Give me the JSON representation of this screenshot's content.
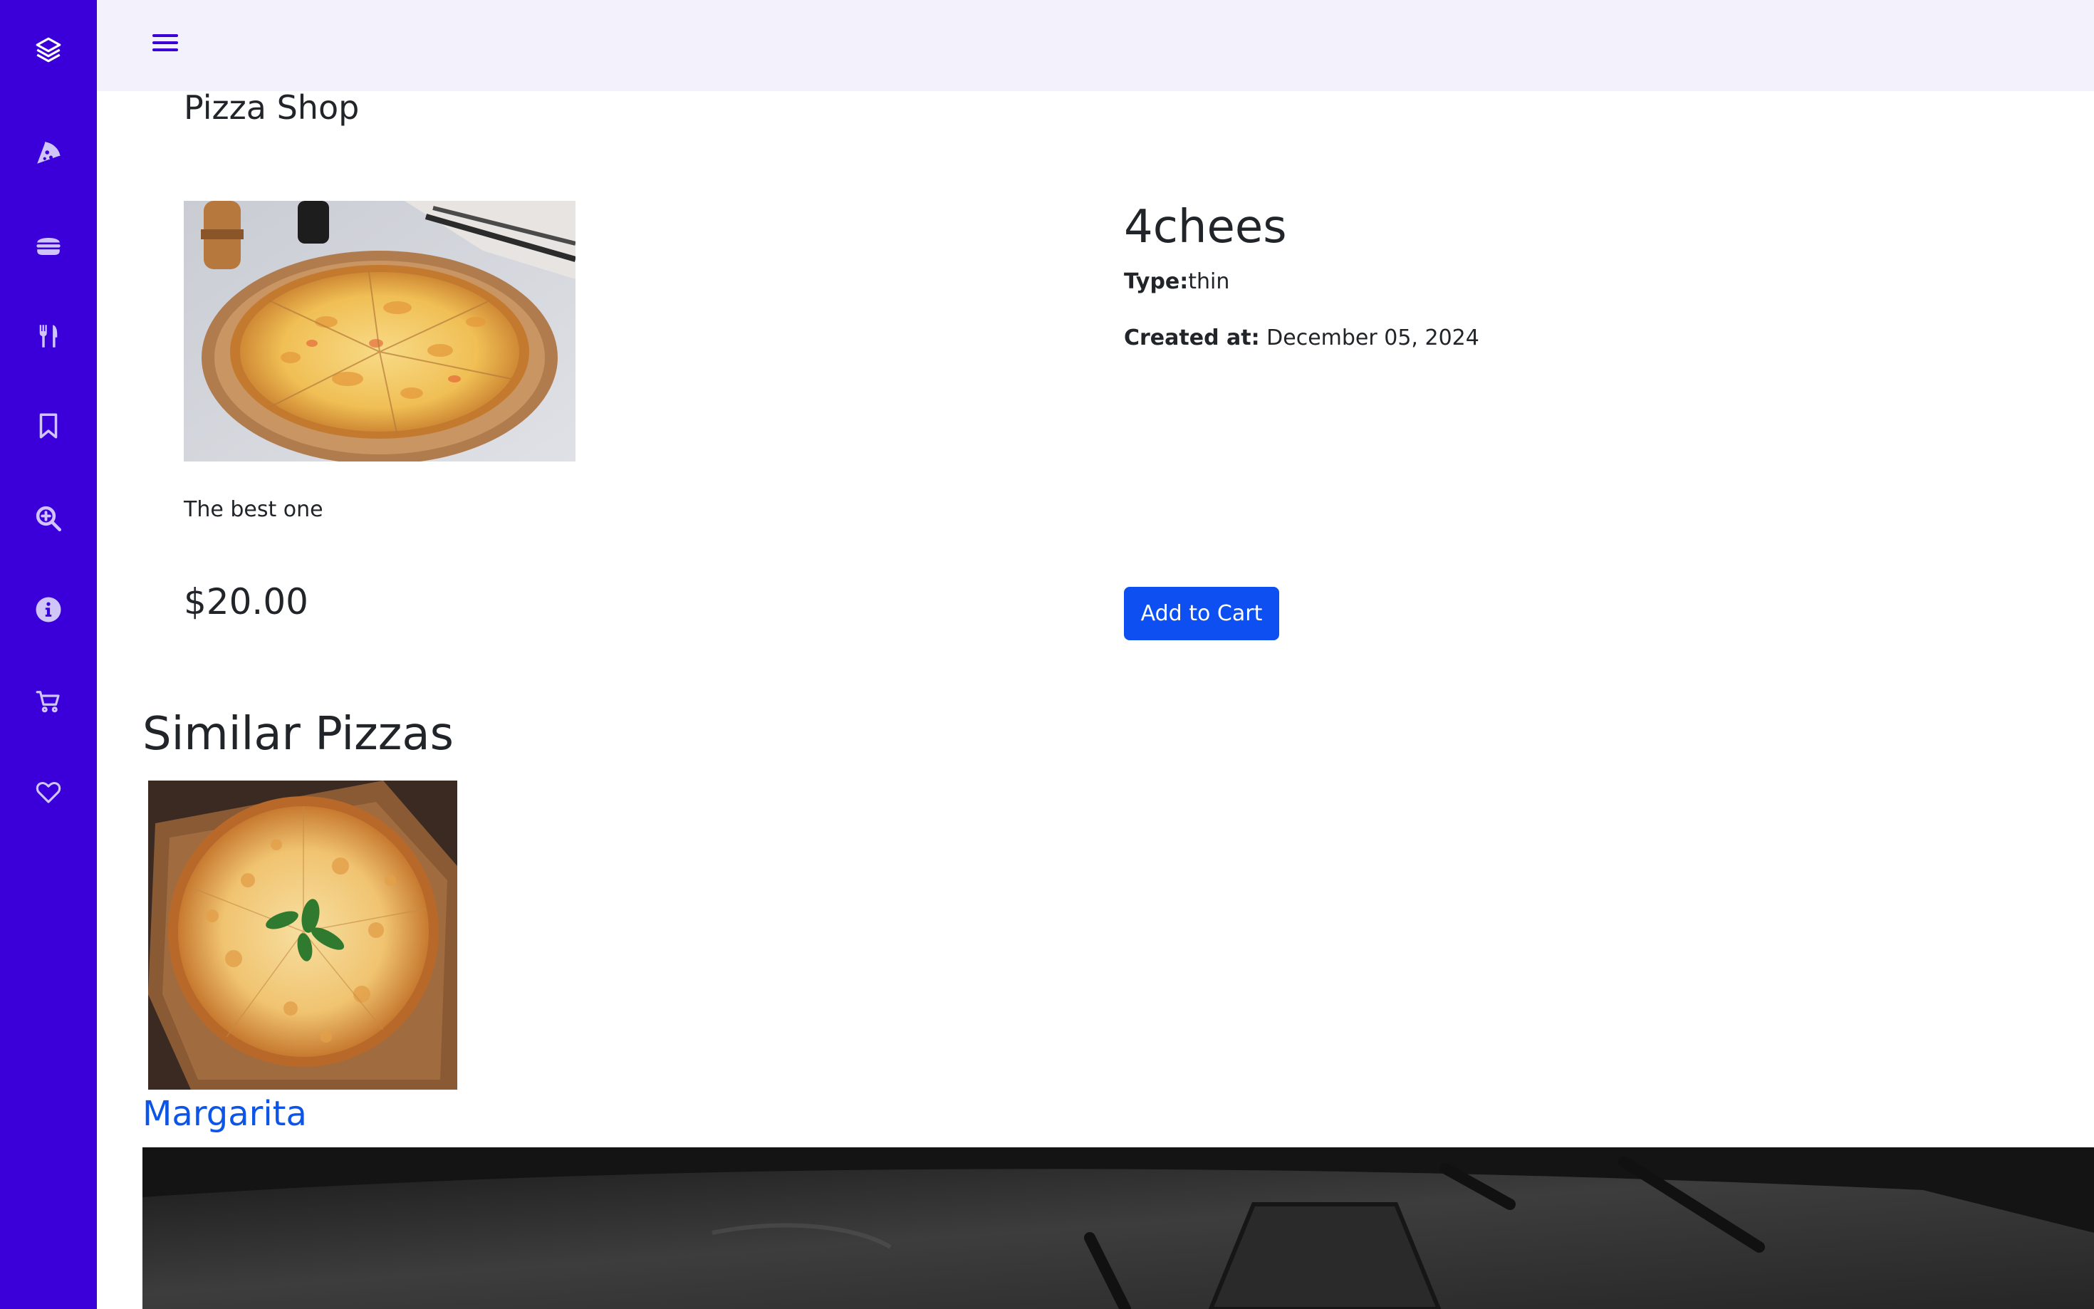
{
  "app": {
    "brand": "Pizza Shop",
    "colors": {
      "sidebar": "#3b00d9",
      "topbar": "#f3f1fc",
      "accent_button": "#0d4ff0",
      "link": "#0d55e6"
    }
  },
  "sidebar": {
    "items": [
      {
        "icon": "layers-icon"
      },
      {
        "icon": "pizza-slice-icon"
      },
      {
        "icon": "burger-icon"
      },
      {
        "icon": "utensils-icon"
      },
      {
        "icon": "bookmark-icon"
      },
      {
        "icon": "search-plus-icon"
      },
      {
        "icon": "info-circle-icon"
      },
      {
        "icon": "cart-icon"
      },
      {
        "icon": "heart-icon"
      }
    ]
  },
  "topbar": {
    "menu_icon": "hamburger-icon"
  },
  "product": {
    "name": "4chees",
    "type_label": "Type:",
    "type_value": "thin",
    "created_label": "Created at:",
    "created_value": "December 05, 2024",
    "description": "The best one",
    "price": "$20.00",
    "add_to_cart_label": "Add to Cart"
  },
  "similar": {
    "title": "Similar Pizzas",
    "items": [
      {
        "name": "Margarita"
      }
    ]
  }
}
